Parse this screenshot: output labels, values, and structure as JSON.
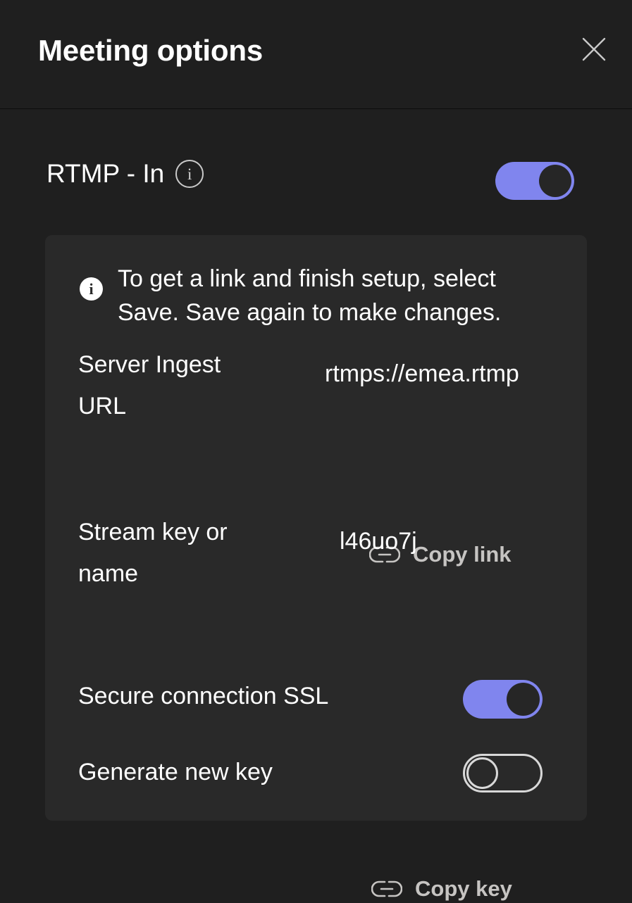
{
  "header": {
    "title": "Meeting options",
    "close_icon": "close-icon"
  },
  "rtmp_section": {
    "label": "RTMP - In",
    "info_icon_glyph": "i",
    "toggle_state": "on"
  },
  "panel": {
    "notice": {
      "icon_glyph": "i",
      "text": "To get a link and finish setup, select Save. Save again to make changes."
    },
    "fields": [
      {
        "label": "Server Ingest URL",
        "value": "rtmps://emea.rtmp",
        "copy_label": "Copy link",
        "copy_icon": "link-icon"
      },
      {
        "label": "Stream key or name",
        "value": "l46uo7j",
        "copy_label": "Copy key",
        "copy_icon": "link-icon"
      }
    ],
    "toggles": [
      {
        "label": "Secure connection SSL",
        "state": "on"
      },
      {
        "label": "Generate new key",
        "state": "off"
      }
    ]
  },
  "colors": {
    "background": "#1f1f1f",
    "panel": "#292929",
    "toggle_on": "#8085ee",
    "toggle_knob_dark": "#262626",
    "toggle_off_outline": "#d8d8d8",
    "text_primary": "#ffffff",
    "text_secondary": "#c6c4c2"
  }
}
